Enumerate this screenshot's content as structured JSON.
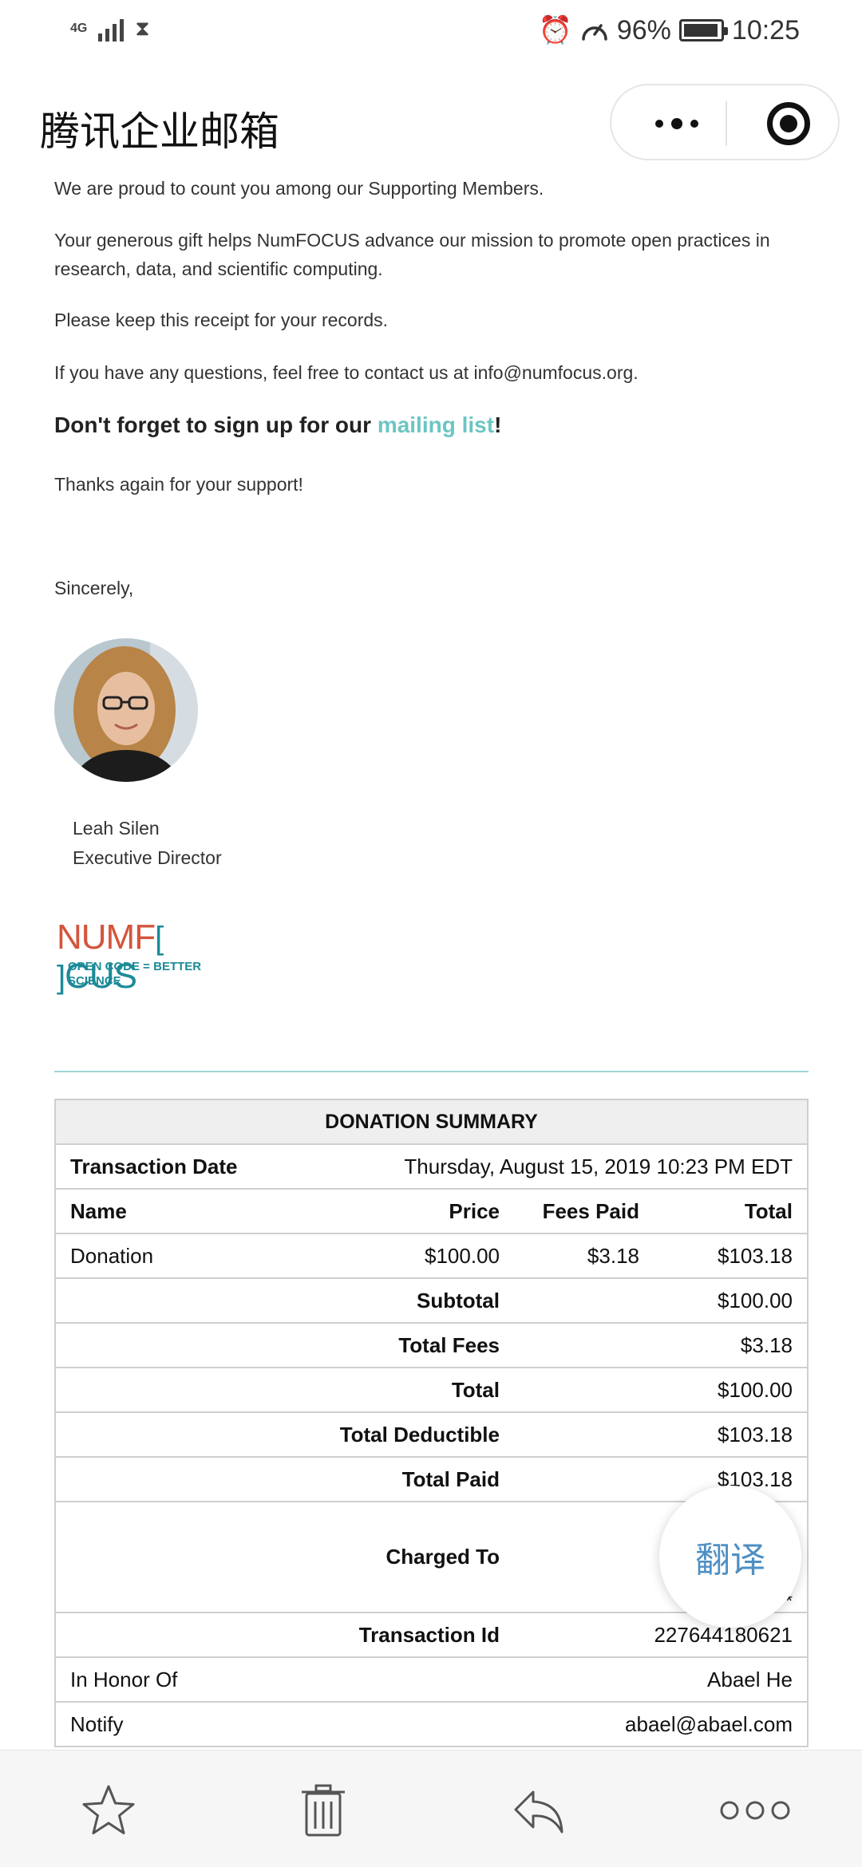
{
  "status_bar": {
    "network": "4G",
    "battery_percent": "96%",
    "battery_level": 0.96,
    "time": "10:25",
    "icons": [
      "signal-icon",
      "hourglass-icon",
      "alarm-icon",
      "speed-icon",
      "battery-icon"
    ]
  },
  "header": {
    "app_title": "腾讯企业邮箱",
    "icons": [
      "more-icon",
      "target-icon"
    ]
  },
  "email": {
    "p1": "We are proud to count you among our Supporting Members.",
    "p2": "Your generous gift helps NumFOCUS advance our mission to promote open practices in research, data, and scientific computing.",
    "p3": "Please keep this receipt for your records.",
    "p4": "If you have any questions, feel free to contact us at info@numfocus.org.",
    "headline_pre": "Don't forget to sign up for our ",
    "headline_link": "mailing list",
    "headline_post": "!",
    "thanks": "Thanks again for your support!",
    "sincerely": "Sincerely,",
    "signer_name": "Leah Silen",
    "signer_title": "Executive Director",
    "logo_word_left": "NUMF",
    "logo_word_right": "CUS",
    "logo_tagline": "OPEN CODE = BETTER SCIENCE"
  },
  "summary": {
    "title": "DONATION SUMMARY",
    "transaction_date_label": "Transaction Date",
    "transaction_date": "Thursday, August 15, 2019 10:23 PM EDT",
    "columns": [
      "Name",
      "Price",
      "Fees Paid",
      "Total"
    ],
    "item": {
      "name": "Donation",
      "price": "$100.00",
      "fees": "$3.18",
      "total": "$103.18"
    },
    "subtotal_label": "Subtotal",
    "subtotal": "$100.00",
    "total_fees_label": "Total Fees",
    "total_fees": "$3.18",
    "total_label": "Total",
    "total": "$100.00",
    "deductible_label": "Total Deductible",
    "deductible": "$103.18",
    "paid_label": "Total Paid",
    "paid": "$103.18",
    "charged_to_label": "Charged To",
    "charged_to": "***",
    "transaction_id_label": "Transaction Id",
    "transaction_id": "227644180621",
    "honor_label": "In Honor Of",
    "honor": "Abael He",
    "notify_label": "Notify",
    "notify": "abael@abael.com"
  },
  "translate_button": "翻译",
  "toolbar": {
    "icons": [
      "star-icon",
      "trash-icon",
      "reply-icon",
      "more-circles-icon"
    ]
  },
  "colors": {
    "link": "#6cc5c3",
    "divider": "#9fd6d5",
    "translate": "#4e8fc4",
    "logo_red": "#d4553c",
    "logo_teal": "#1b8a98"
  }
}
